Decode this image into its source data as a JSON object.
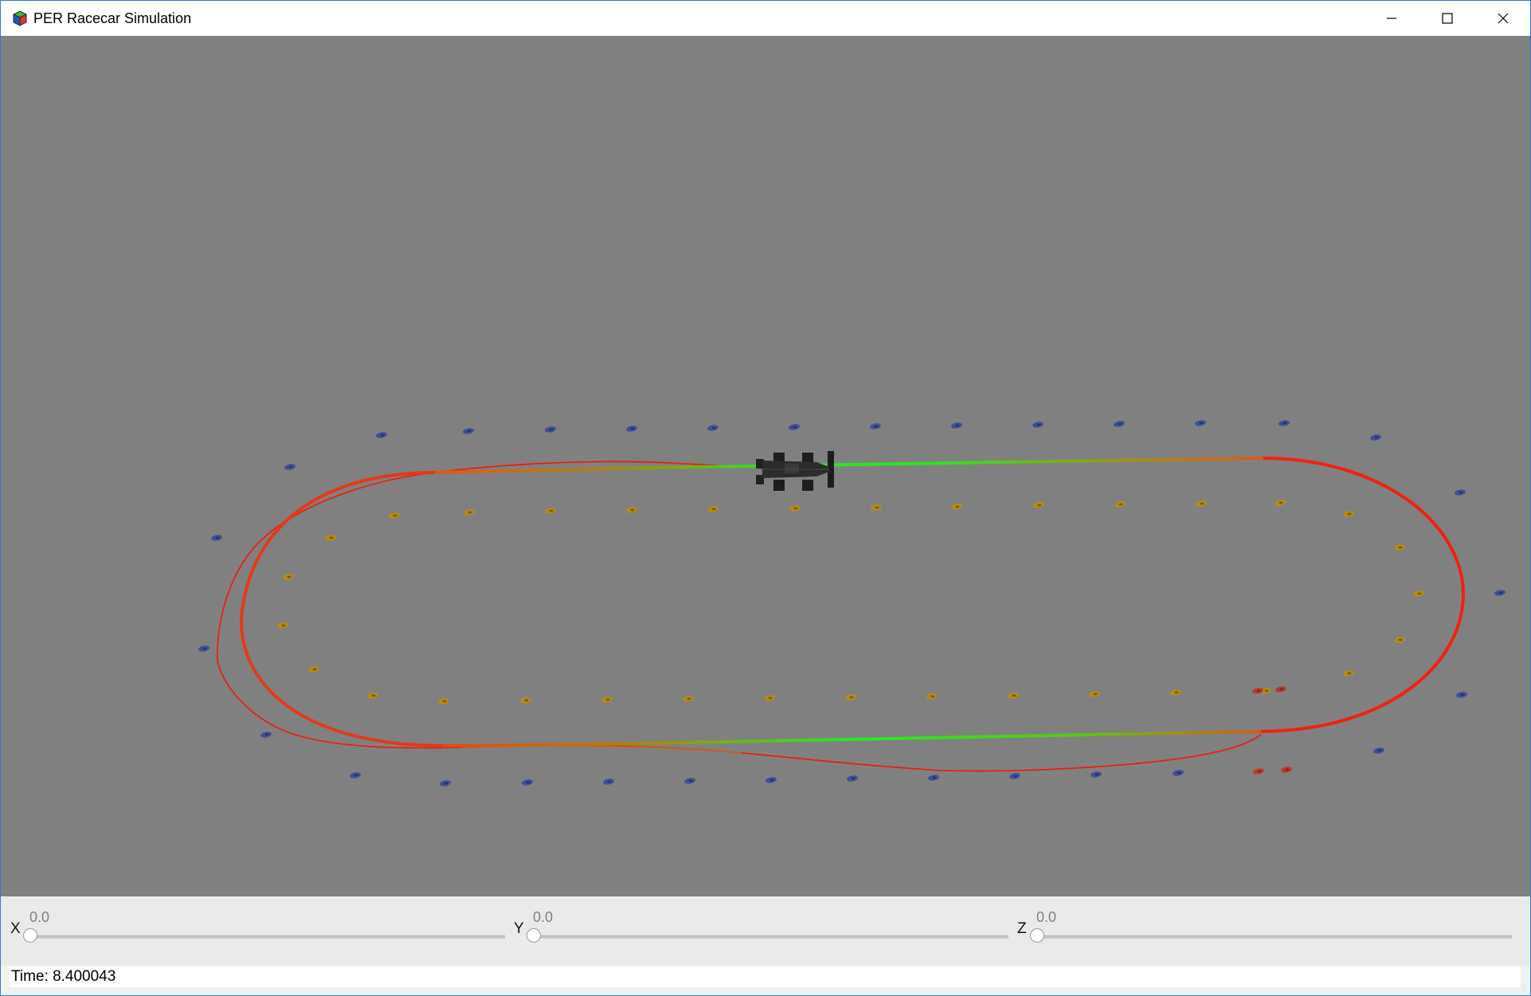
{
  "window": {
    "title": "PER Racecar Simulation",
    "controls": [
      "minimize-icon",
      "maximize-icon",
      "close-icon"
    ]
  },
  "viewport": {
    "background": "#808080",
    "cone_colors": {
      "blue": "#3d4f9a",
      "yellow": "#b88a14",
      "orange": "#b83a2a"
    },
    "path_colors": [
      "#22ee22",
      "#e0421a",
      "#ff1a0a"
    ]
  },
  "sliders": [
    {
      "axis": "X",
      "value": "0.0",
      "fraction": 0.0
    },
    {
      "axis": "Y",
      "value": "0.0",
      "fraction": 0.0
    },
    {
      "axis": "Z",
      "value": "0.0",
      "fraction": 0.0
    }
  ],
  "status": {
    "time_label": "Time: 8.400043"
  }
}
